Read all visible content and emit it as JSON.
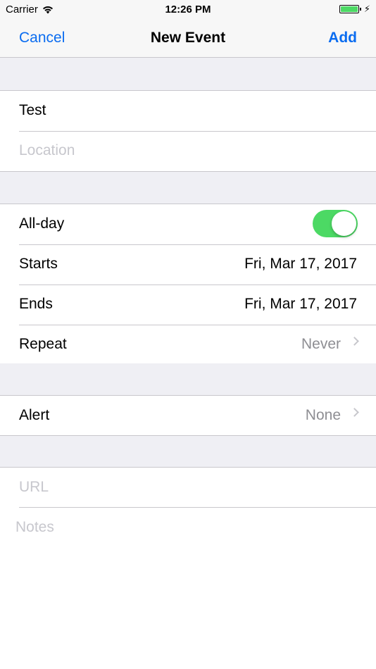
{
  "status_bar": {
    "carrier": "Carrier",
    "time": "12:26 PM",
    "battery_level": 1.0
  },
  "nav": {
    "cancel_label": "Cancel",
    "title": "New Event",
    "add_label": "Add"
  },
  "event": {
    "title_value": "Test",
    "location_placeholder": "Location"
  },
  "schedule": {
    "all_day_label": "All-day",
    "all_day_on": true,
    "starts_label": "Starts",
    "starts_value": "Fri, Mar 17, 2017",
    "ends_label": "Ends",
    "ends_value": "Fri, Mar 17, 2017",
    "repeat_label": "Repeat",
    "repeat_value": "Never"
  },
  "alert": {
    "label": "Alert",
    "value": "None"
  },
  "extras": {
    "url_placeholder": "URL",
    "notes_placeholder": "Notes"
  },
  "colors": {
    "tint": "#0a6cf0",
    "toggle_on": "#4cd964",
    "group_background": "#efeff4"
  }
}
